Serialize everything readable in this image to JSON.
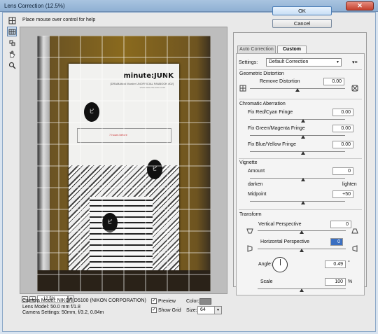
{
  "window": {
    "title": "Lens Correction (12.5%)",
    "close_glyph": "✕"
  },
  "toolbar": {
    "tools": [
      "remove-distortion-tool",
      "straighten-tool",
      "move-grid-tool",
      "hand-tool",
      "zoom-tool"
    ]
  },
  "help_text": "Place mouse over control for help",
  "preview": {
    "cover_title": "minute:JUNK",
    "cover_subtitle": "[DRAMAtical Murder UNOFFICIAL FANBOOK #02]",
    "cover_small": "WWW.MINUTEJUNK.COM",
    "box_text": "7 hours before",
    "blob1": "ピ",
    "blob2": "ピ",
    "blob3": "ピ"
  },
  "zoom": {
    "minus": "−",
    "plus": "+",
    "value": "12.5%",
    "arrow": "▼"
  },
  "camera": {
    "model": "Camera Model: NIKON D5100 (NIKON CORPORATION)",
    "lens": "Lens Model: 50.0 mm f/1.8",
    "settings": "Camera Settings: 50mm, f/3.2, 0.84m"
  },
  "bottom": {
    "preview_label": "Preview",
    "show_grid_label": "Show Grid",
    "check_mark": "✓",
    "color_label": "Color:",
    "grid_color": "#888888",
    "size_label": "Size:",
    "size_value": "64",
    "size_arrow": "▼"
  },
  "buttons": {
    "ok": "OK",
    "cancel": "Cancel"
  },
  "tabs": [
    {
      "label": "Auto Correction"
    },
    {
      "label": "Custom"
    }
  ],
  "panel": {
    "settings_label": "Settings:",
    "settings_value": "Default Correction",
    "settings_arrow": "▼",
    "menu_glyph": "▾≡",
    "geometric_title": "Geometric Distortion",
    "remove_distortion_label": "Remove Distortion",
    "remove_distortion_value": "0.00",
    "chromatic_title": "Chromatic Aberration",
    "fix_red_label": "Fix Red/Cyan Fringe",
    "fix_red_value": "0.00",
    "fix_green_label": "Fix Green/Magenta Fringe",
    "fix_green_value": "0.00",
    "fix_blue_label": "Fix Blue/Yellow Fringe",
    "fix_blue_value": "0.00",
    "vignette_title": "Vignette",
    "amount_label": "Amount",
    "amount_value": "0",
    "darken_label": "darken",
    "lighten_label": "lighten",
    "midpoint_label": "Midpoint",
    "midpoint_value": "+50",
    "transform_title": "Transform",
    "vertical_label": "Vertical Perspective",
    "vertical_value": "0",
    "horizontal_label": "Horizontal Perspective",
    "horizontal_value": "0",
    "angle_label": "Angle:",
    "angle_value": "0.49",
    "angle_unit": "°",
    "scale_label": "Scale",
    "scale_value": "100",
    "scale_unit": "%"
  },
  "slider_positions": {
    "remove_distortion": 0.5,
    "fix_red": 0.5,
    "fix_green": 0.5,
    "fix_blue": 0.5,
    "amount": 0.5,
    "midpoint": 0.5,
    "vertical": 0.5,
    "horizontal": 0.5,
    "scale": 0.5
  }
}
